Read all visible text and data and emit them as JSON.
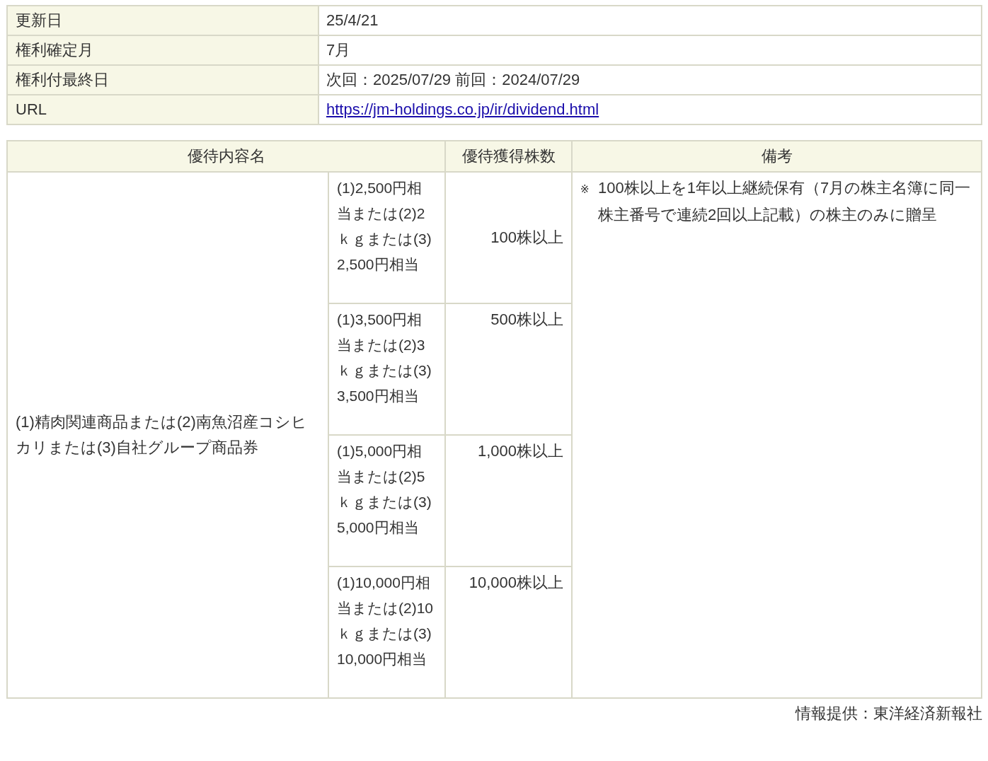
{
  "info_table": {
    "rows": [
      {
        "label": "更新日",
        "value": "25/4/21",
        "kind": "text"
      },
      {
        "label": "権利確定月",
        "value": "7月",
        "kind": "text"
      },
      {
        "label": "権利付最終日",
        "value": "次回：2025/07/29 前回：2024/07/29",
        "kind": "text"
      },
      {
        "label": "URL",
        "value": "https://jm-holdings.co.jp/ir/dividend.html",
        "kind": "link"
      }
    ]
  },
  "benefit_table": {
    "columns": [
      "優待内容名",
      "優待獲得株数",
      "備考"
    ],
    "rows": [
      {
        "name": "(1)精肉関連商品または(2)南魚沼産コシヒカリまたは(3)自社グループ商品券",
        "note_mark": "※",
        "note": "100株以上を1年以上継続保有（7月の株主名簿に同一株主番号で連続2回以上記載）の株主のみに贈呈",
        "tiers": [
          {
            "content": "(1)2,500円相当または(2)2ｋｇまたは(3)2,500円相当",
            "shares": "100株以上"
          },
          {
            "content": "(1)3,500円相当または(2)3ｋｇまたは(3)3,500円相当",
            "shares": "500株以上"
          },
          {
            "content": "(1)5,000円相当または(2)5ｋｇまたは(3)5,000円相当",
            "shares": "1,000株以上"
          },
          {
            "content": "(1)10,000円相当または(2)10ｋｇまたは(3)10,000円相当",
            "shares": "10,000株以上"
          }
        ]
      }
    ]
  },
  "source": "情報提供：東洋経済新報社"
}
